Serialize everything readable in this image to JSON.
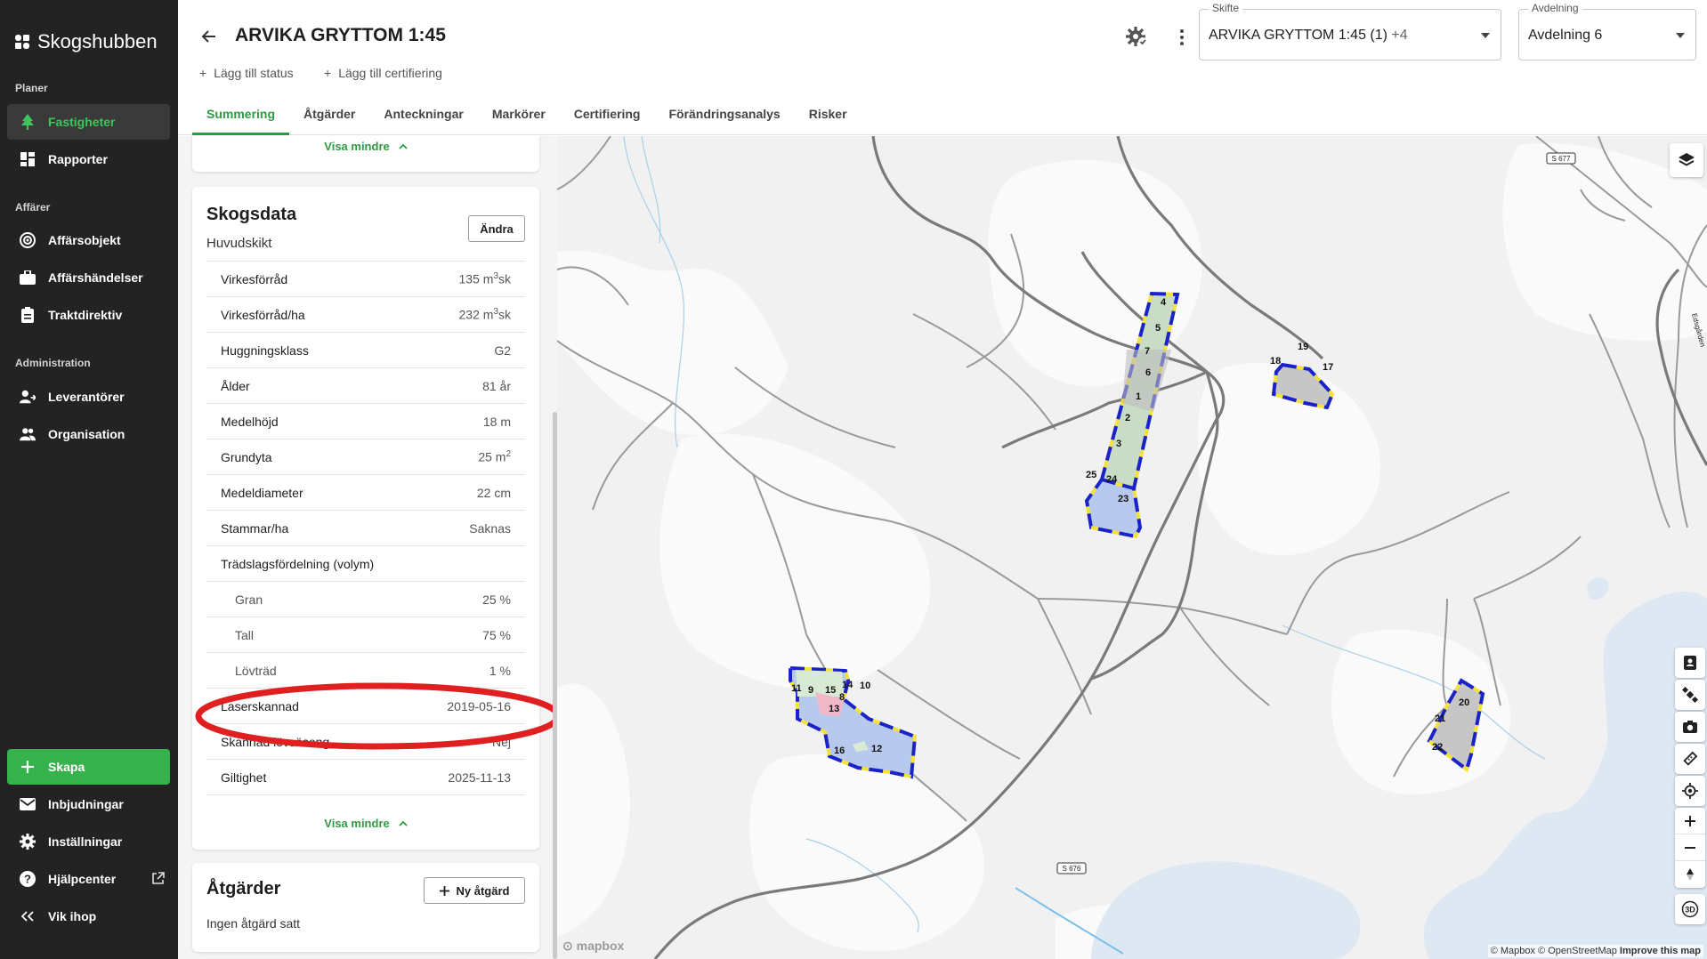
{
  "sidebar": {
    "logo": "Skogshubben",
    "sections": [
      {
        "title": "Planer",
        "items": [
          {
            "label": "Fastigheter",
            "icon": "tree-icon"
          },
          {
            "label": "Rapporter",
            "icon": "dashboard-icon"
          }
        ]
      },
      {
        "title": "Affärer",
        "items": [
          {
            "label": "Affärsobjekt",
            "icon": "target-icon"
          },
          {
            "label": "Affärshändelser",
            "icon": "briefcase-icon"
          },
          {
            "label": "Traktdirektiv",
            "icon": "clipboard-icon"
          }
        ]
      },
      {
        "title": "Administration",
        "items": [
          {
            "label": "Leverantörer",
            "icon": "supplier-icon"
          },
          {
            "label": "Organisation",
            "icon": "people-icon"
          }
        ]
      }
    ],
    "bottom": {
      "create": "Skapa",
      "invites": "Inbjudningar",
      "settings": "Inställningar",
      "help": "Hjälpcenter",
      "collapse": "Vik ihop"
    }
  },
  "header": {
    "title": "ARVIKA GRYTTOM 1:45",
    "add_status": "Lägg till status",
    "add_cert": "Lägg till certifiering",
    "tabs": [
      "Summering",
      "Åtgärder",
      "Anteckningar",
      "Markörer",
      "Certifiering",
      "Förändringsanalys",
      "Risker"
    ],
    "skifte": {
      "label": "Skifte",
      "value": "ARVIKA GRYTTOM 1:45 (1)",
      "extra": "+4"
    },
    "avdelning": {
      "label": "Avdelning",
      "value": "Avdelning 6"
    }
  },
  "panel": {
    "visa_mindre": "Visa mindre",
    "skogsdata": {
      "title": "Skogsdata",
      "subtitle": "Huvudskikt",
      "edit": "Ändra",
      "rows": [
        {
          "label": "Virkesförråd",
          "value": "135 m",
          "sup": "3",
          "suffix": "sk"
        },
        {
          "label": "Virkesförråd/ha",
          "value": "232 m",
          "sup": "3",
          "suffix": "sk"
        },
        {
          "label": "Huggningsklass",
          "value": "G2"
        },
        {
          "label": "Ålder",
          "value": "81 år"
        },
        {
          "label": "Medelhöjd",
          "value": "18 m"
        },
        {
          "label": "Grundyta",
          "value": "25 m",
          "sup": "2",
          "suffix": ""
        },
        {
          "label": "Medeldiameter",
          "value": "22 cm"
        },
        {
          "label": "Stammar/ha",
          "value": "Saknas"
        },
        {
          "label": "Trädslagsfördelning (volym)",
          "value": ""
        },
        {
          "label": "Gran",
          "value": "25 %",
          "sub": true
        },
        {
          "label": "Tall",
          "value": "75 %",
          "sub": true
        },
        {
          "label": "Lövträd",
          "value": "1 %",
          "sub": true
        },
        {
          "label": "Laserskannad",
          "value": "2019-05-16"
        },
        {
          "label": "Skannad lövsäsong",
          "value": "Nej"
        },
        {
          "label": "Giltighet",
          "value": "2025-11-13"
        }
      ]
    },
    "atgarder": {
      "title": "Åtgärder",
      "new": "Ny åtgärd",
      "empty": "Ingen åtgärd satt"
    }
  },
  "map": {
    "road_labels": [
      "S 677",
      "S 676"
    ],
    "street_label": "Edsgården",
    "mapbox": "mapbox",
    "attribution": {
      "a": "© Mapbox © OpenStreetMap",
      "b": "Improve this map"
    },
    "stand_numbers": [
      "4",
      "5",
      "7",
      "6",
      "1",
      "2",
      "3",
      "25",
      "24",
      "23",
      "19",
      "18",
      "17",
      "11",
      "9",
      "15",
      "14",
      "10",
      "8",
      "13",
      "16",
      "12",
      "20",
      "21",
      "22"
    ],
    "controls": [
      "layers-icon",
      "contact-icon",
      "satellite-icon",
      "camera-icon",
      "ruler-icon",
      "locate-icon",
      "zoom-in-icon",
      "zoom-out-icon",
      "compass-icon",
      "3d-icon"
    ],
    "label_3d": "3D"
  },
  "colors": {
    "accent": "#2e9a41",
    "sidebar_bg": "#232323",
    "create_btn": "#36b24c",
    "highlight_ellipse": "#e02020",
    "stand_border_blue": "#1a23c8",
    "stand_border_yellow": "#f4e23a"
  }
}
